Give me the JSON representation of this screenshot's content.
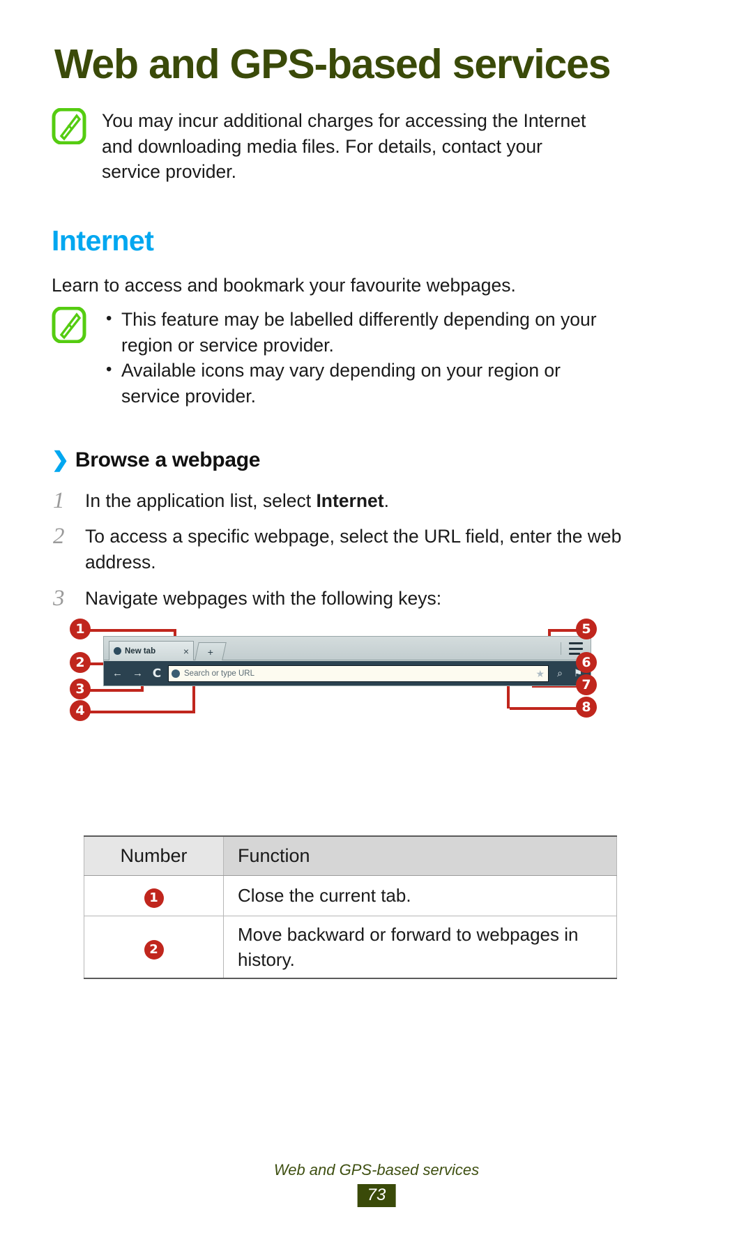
{
  "document": {
    "title": "Web and GPS-based services",
    "footer_title": "Web and GPS-based services",
    "page_number": "73"
  },
  "top_note": {
    "icon": "note-pencil-icon",
    "text": "You may incur additional charges for accessing the Internet and downloading media files. For details, contact your service provider."
  },
  "internet_section": {
    "heading": "Internet",
    "lead": "Learn to access and bookmark your favourite webpages.",
    "note": {
      "icon": "note-pencil-icon",
      "bullets": [
        "This feature may be labelled differently depending on your region or service provider.",
        "Available icons may vary depending on your region or service provider."
      ]
    }
  },
  "browse_section": {
    "chevron": "❯",
    "heading": "Browse a webpage",
    "steps": [
      {
        "num": "1",
        "text_before": "In the application list, select ",
        "bold": "Internet",
        "text_after": "."
      },
      {
        "num": "2",
        "text_before": "To access a specific webpage, select the URL field, enter the web address.",
        "bold": "",
        "text_after": ""
      },
      {
        "num": "3",
        "text_before": "Navigate webpages with the following keys:",
        "bold": "",
        "text_after": ""
      }
    ]
  },
  "browser_mock": {
    "tab_label": "New tab",
    "tab_close": "×",
    "new_tab_plus": "+",
    "back_arrow": "←",
    "forward_arrow": "→",
    "reload_glyph": "C",
    "url_placeholder": "Search or type URL",
    "bookmark_star": "★",
    "search_glyph": "⌕",
    "bookmarks_glyph": "⚑",
    "menu_icon": "menu-icon"
  },
  "callouts": [
    {
      "id": "1",
      "label": "1"
    },
    {
      "id": "2",
      "label": "2"
    },
    {
      "id": "3",
      "label": "3"
    },
    {
      "id": "4",
      "label": "4"
    },
    {
      "id": "5",
      "label": "5"
    },
    {
      "id": "6",
      "label": "6"
    },
    {
      "id": "7",
      "label": "7"
    },
    {
      "id": "8",
      "label": "8"
    }
  ],
  "function_table": {
    "columns": [
      "Number",
      "Function"
    ],
    "rows": [
      {
        "number": "1",
        "function": "Close the current tab."
      },
      {
        "number": "2",
        "function": "Move backward or forward to webpages in history."
      }
    ]
  },
  "colors": {
    "title_green": "#3a4a09",
    "accent_blue": "#00a7f0",
    "callout_red": "#c0261d",
    "note_green": "#55cc11"
  }
}
